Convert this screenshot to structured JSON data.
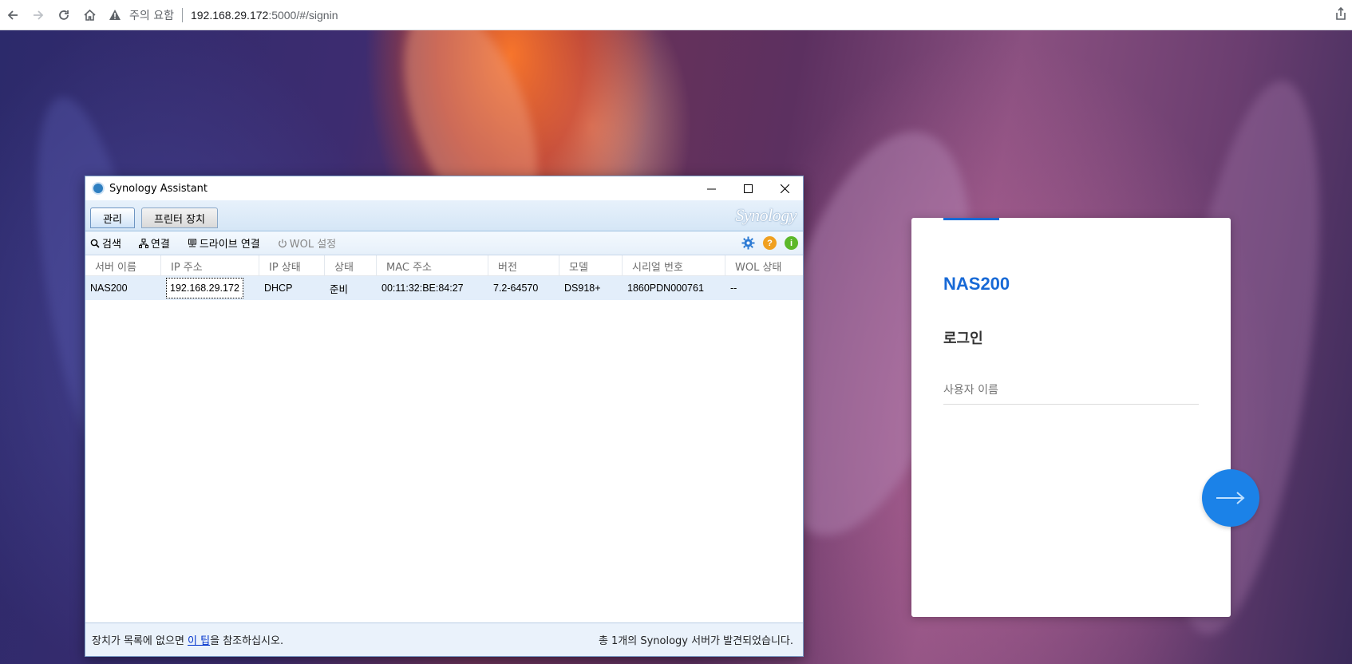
{
  "browser": {
    "security_warning": "주의 요함",
    "url_host": "192.168.29.172",
    "url_rest": ":5000/#/signin"
  },
  "login": {
    "host_name": "NAS200",
    "title": "로그인",
    "username_placeholder": "사용자 이름"
  },
  "assistant": {
    "window_title": "Synology Assistant",
    "brand": "Synology",
    "tabs": [
      {
        "label": "관리",
        "active": true
      },
      {
        "label": "프린터 장치",
        "active": false
      }
    ],
    "toolbar": {
      "search": "검색",
      "connect": "연결",
      "map_drive": "드라이브 연결",
      "wol_settings": "WOL 설정"
    },
    "columns": [
      "서버 이름",
      "IP 주소",
      "IP 상태",
      "상태",
      "MAC 주소",
      "버전",
      "모델",
      "시리얼 번호",
      "WOL 상태"
    ],
    "rows": [
      {
        "server_name": "NAS200",
        "ip": "192.168.29.172",
        "ip_status": "DHCP",
        "status": "준비",
        "mac": "00:11:32:BE:84:27",
        "version": "7.2-64570",
        "model": "DS918+",
        "serial": "1860PDN000761",
        "wol_status": "--"
      }
    ],
    "status_bar": {
      "hint_before": "장치가 목록에 없으면 ",
      "hint_link": "이 팁",
      "hint_after": "을 참조하십시오.",
      "found_count": "총 1개의 Synology 서버가 발견되었습니다."
    }
  },
  "colors": {
    "accent_blue": "#1769d6",
    "go_button": "#1b82e8"
  }
}
